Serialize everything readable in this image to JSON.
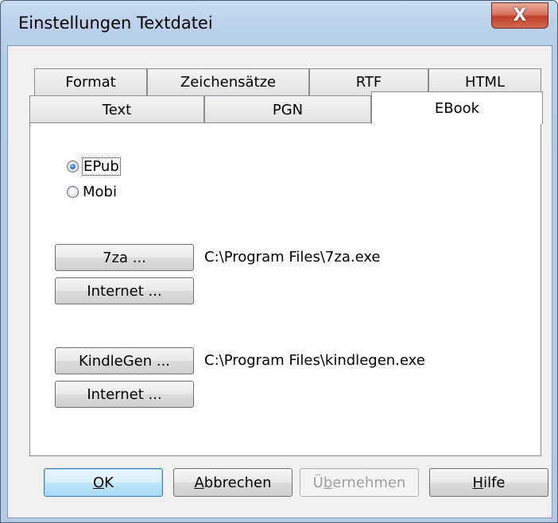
{
  "window": {
    "title": "Einstellungen Textdatei",
    "close_glyph": "X"
  },
  "tabs_row1": [
    {
      "label": "Format"
    },
    {
      "label": "Zeichensätze"
    },
    {
      "label": "RTF"
    },
    {
      "label": "HTML"
    }
  ],
  "tabs_row2": [
    {
      "label": "Text"
    },
    {
      "label": "PGN"
    },
    {
      "label": "EBook",
      "active": true
    }
  ],
  "ebook": {
    "format_options": [
      {
        "label": "EPub",
        "selected": true
      },
      {
        "label": "Mobi",
        "selected": false
      }
    ],
    "sevenza_button": "7za ...",
    "sevenza_path": "C:\\Program Files\\7za.exe",
    "sevenza_internet_button": "Internet ...",
    "kindlegen_button": "KindleGen ...",
    "kindlegen_path": "C:\\Program Files\\kindlegen.exe",
    "kindlegen_internet_button": "Internet ..."
  },
  "footer": {
    "ok": {
      "mnemonic": "O",
      "rest": "K"
    },
    "cancel": {
      "mnemonic": "A",
      "rest": "bbrechen"
    },
    "apply": {
      "pre": "Ü",
      "mnemonic": "b",
      "rest": "ernehmen",
      "enabled": false
    },
    "help": {
      "mnemonic": "H",
      "rest": "ilfe"
    }
  },
  "colors": {
    "accent": "#3c7fb1",
    "close": "#c2402a"
  }
}
